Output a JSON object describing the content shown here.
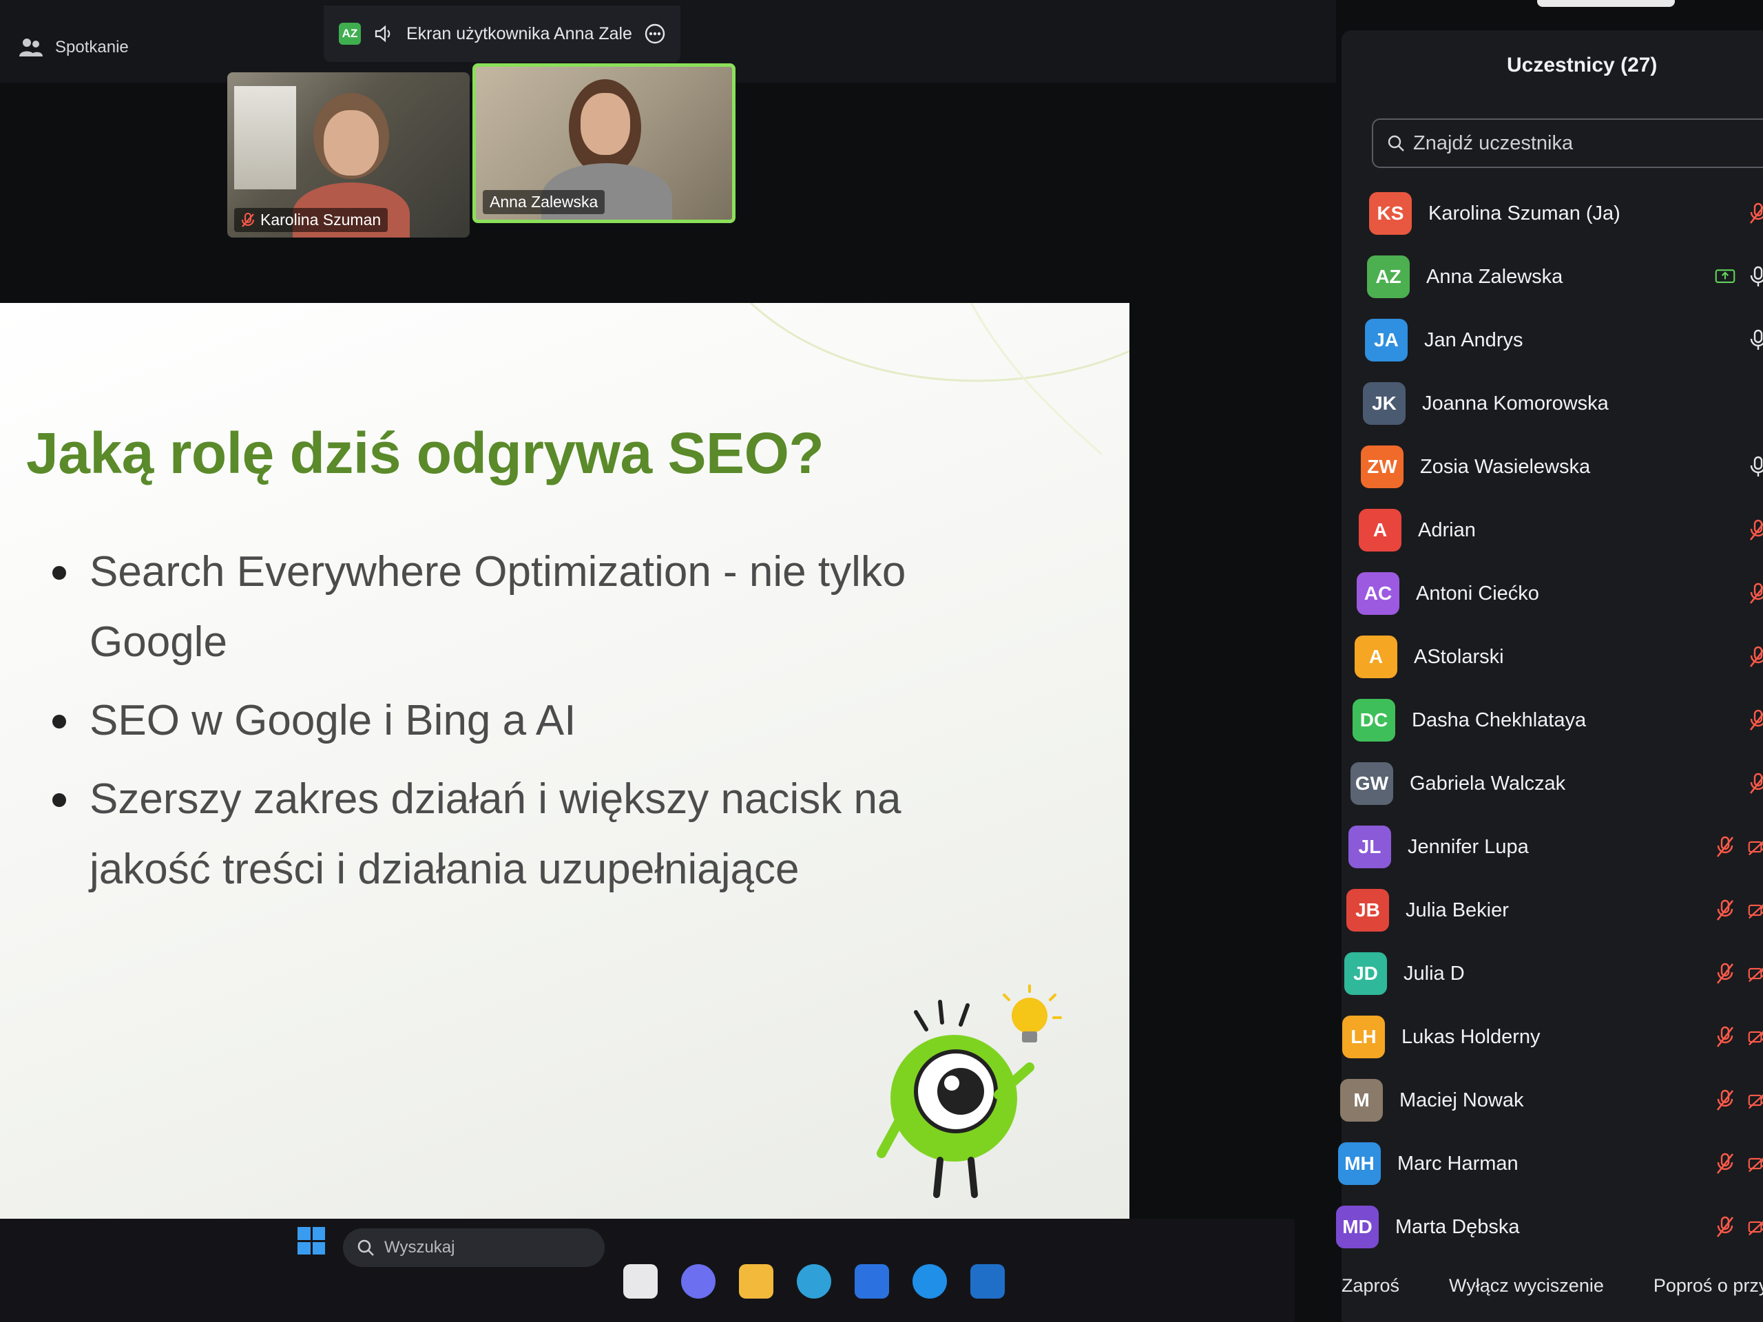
{
  "topbar": {
    "meeting_label": "Spotkanie",
    "share_avatar": "AZ",
    "share_text": "Ekran użytkownika Anna Zale"
  },
  "videos": [
    {
      "name": "Karolina Szuman"
    },
    {
      "name": "Anna Zalewska"
    }
  ],
  "slide": {
    "title": "Jaką rolę dziś odgrywa SEO?",
    "bullets": [
      "Search Everywhere Optimization - nie tylko Google",
      "SEO w Google i Bing a AI",
      "Szerszy zakres działań i większy nacisk na jakość treści i działania uzupełniające"
    ],
    "accent_color": "#5a8a2a"
  },
  "taskbar": {
    "search_placeholder": "Wyszukaj"
  },
  "participants_panel": {
    "title": "Uczestnicy (27)",
    "search_placeholder": "Znajdź uczestnika",
    "participants": [
      {
        "initials": "KS",
        "name": "Karolina Szuman (Ja)",
        "color": "#e8573f",
        "mic": "muted",
        "camera": "on"
      },
      {
        "initials": "AZ",
        "name": "Anna Zalewska",
        "color": "#4caf50",
        "mic": "on",
        "camera": "on",
        "sharing": true
      },
      {
        "initials": "JA",
        "name": "Jan Andrys",
        "color": "#2f8fe0",
        "mic": "on",
        "camera": "on"
      },
      {
        "initials": "JK",
        "name": "Joanna Komorowska",
        "color": "#4a5a70",
        "mic": "none",
        "camera": "none"
      },
      {
        "initials": "ZW",
        "name": "Zosia Wasielewska",
        "color": "#f06a2a",
        "mic": "on",
        "camera": "on"
      },
      {
        "initials": "A",
        "name": "Adrian",
        "color": "#e8453c",
        "mic": "muted",
        "camera": "none"
      },
      {
        "initials": "AC",
        "name": "Antoni Ciećko",
        "color": "#9c5ae0",
        "mic": "muted",
        "camera": "none"
      },
      {
        "initials": "A",
        "name": "AStolarski",
        "color": "#f5a623",
        "mic": "muted",
        "camera": "none"
      },
      {
        "initials": "DC",
        "name": "Dasha Chekhlataya",
        "color": "#3fbf5a",
        "mic": "muted",
        "camera": "none"
      },
      {
        "initials": "GW",
        "name": "Gabriela Walczak",
        "color": "#5a6472",
        "mic": "muted",
        "camera": "none"
      },
      {
        "initials": "JL",
        "name": "Jennifer Lupa",
        "color": "#8a5ad8",
        "mic": "muted",
        "camera": "off"
      },
      {
        "initials": "JB",
        "name": "Julia Bekier",
        "color": "#e0453a",
        "mic": "muted",
        "camera": "off"
      },
      {
        "initials": "JD",
        "name": "Julia D",
        "color": "#2fb89a",
        "mic": "muted",
        "camera": "off"
      },
      {
        "initials": "LH",
        "name": "Lukas Holderny",
        "color": "#f5a623",
        "mic": "muted",
        "camera": "off"
      },
      {
        "initials": "M",
        "name": "Maciej Nowak",
        "color": "#8a7a6a",
        "mic": "muted",
        "camera": "off"
      },
      {
        "initials": "MH",
        "name": "Marc Harman",
        "color": "#2f8fe0",
        "mic": "muted",
        "camera": "off"
      },
      {
        "initials": "MD",
        "name": "Marta Dębska",
        "color": "#7a4ad0",
        "mic": "muted",
        "camera": "off"
      }
    ],
    "footer": {
      "invite": "Zaproś",
      "unmute_all": "Wyłącz wyciszenie",
      "ask": "Poproś o przywró"
    }
  }
}
